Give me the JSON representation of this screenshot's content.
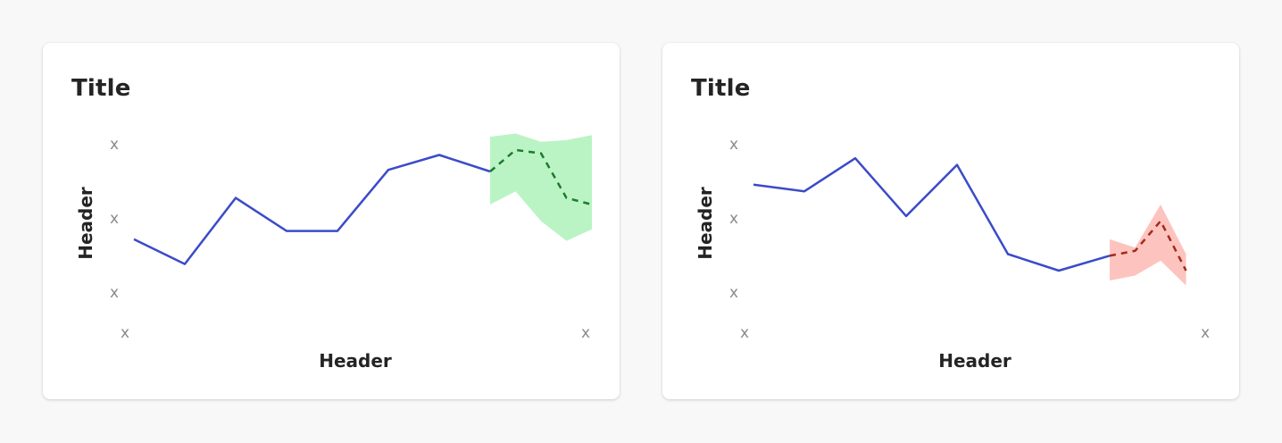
{
  "chart_data": [
    {
      "type": "line",
      "title": "Title",
      "xlabel": "Header",
      "ylabel": "Header",
      "x_tick_labels": [
        "x",
        "x"
      ],
      "y_tick_labels": [
        "x",
        "x",
        "x"
      ],
      "ylim": [
        0,
        1
      ],
      "actual": {
        "x": [
          0,
          1,
          2,
          3,
          4,
          5,
          6,
          7
        ],
        "y": [
          0.39,
          0.24,
          0.64,
          0.44,
          0.44,
          0.81,
          0.9,
          0.8
        ]
      },
      "forecast": {
        "x": [
          7,
          7.5,
          8,
          8.5,
          9
        ],
        "y": [
          0.8,
          0.93,
          0.91,
          0.64,
          0.6
        ],
        "upper": [
          1.01,
          1.03,
          0.98,
          0.99,
          1.02
        ],
        "lower": [
          0.6,
          0.68,
          0.5,
          0.38,
          0.45
        ]
      },
      "colors": {
        "line": "#3b4bc8",
        "forecast_line": "#1e7a2e",
        "band": "#baf4c4"
      }
    },
    {
      "type": "line",
      "title": "Title",
      "xlabel": "Header",
      "ylabel": "Header",
      "x_tick_labels": [
        "x",
        "x"
      ],
      "y_tick_labels": [
        "x",
        "x",
        "x"
      ],
      "ylim": [
        0,
        1
      ],
      "actual": {
        "x": [
          0,
          1,
          2,
          3,
          4,
          5,
          6,
          7
        ],
        "y": [
          0.72,
          0.68,
          0.88,
          0.53,
          0.84,
          0.3,
          0.2,
          0.29
        ]
      },
      "forecast": {
        "x": [
          7,
          7.5,
          8,
          8.5
        ],
        "y": [
          0.29,
          0.32,
          0.5,
          0.2
        ],
        "upper": [
          0.39,
          0.34,
          0.6,
          0.3
        ],
        "lower": [
          0.14,
          0.17,
          0.26,
          0.11
        ]
      },
      "colors": {
        "line": "#3b4bc8",
        "forecast_line": "#a32a1e",
        "band": "#fdc4bf"
      }
    }
  ]
}
